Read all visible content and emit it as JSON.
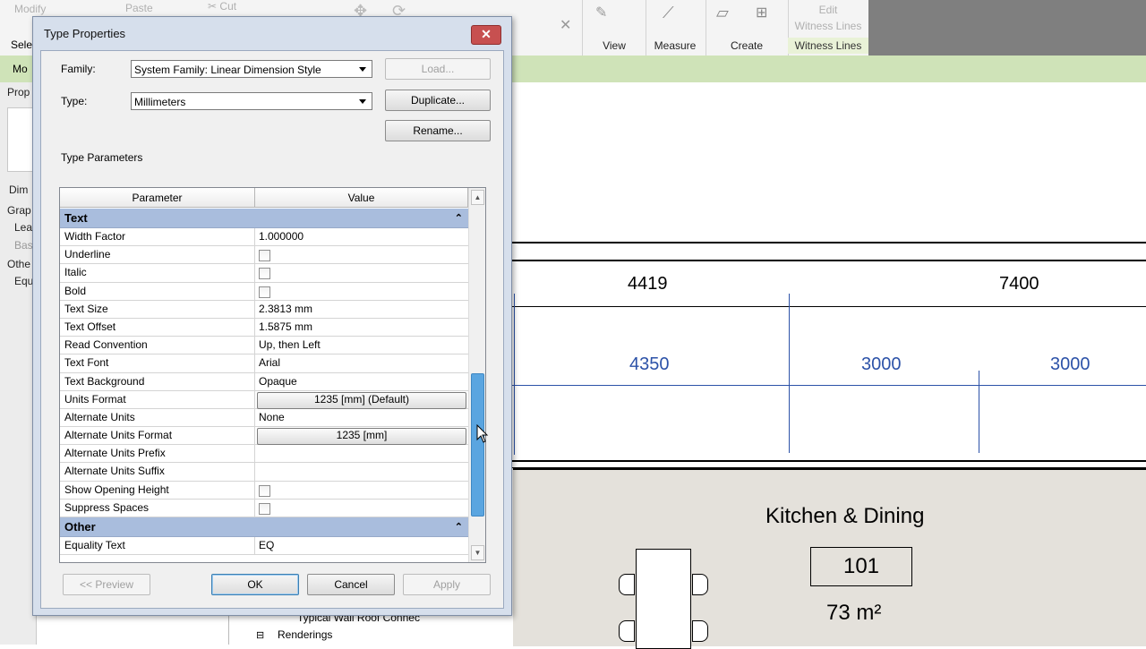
{
  "ribbon": {
    "modify_label": "Modify",
    "paste_label": "Paste",
    "cut_label": "Cut",
    "select_label": "Sele",
    "panels": [
      {
        "label": "View"
      },
      {
        "label": "Measure"
      },
      {
        "label": "Create"
      }
    ],
    "edit_witness": "Edit\nWitness Lines",
    "witness_lines_label": "Witness Lines",
    "context_tab": "Mo"
  },
  "left_panel": {
    "items": [
      "Prop",
      "Dim",
      "Grap",
      "Lea",
      "Bas",
      "Othe",
      "Equ"
    ]
  },
  "drawing": {
    "dims_top": [
      "4419",
      "7400"
    ],
    "dims_blue": [
      "4350",
      "3000",
      "3000"
    ],
    "room_name": "Kitchen & Dining",
    "room_number": "101",
    "room_area": "73 m²",
    "browser_items": [
      "Typical Wall Roof Connec",
      "Renderings"
    ]
  },
  "dialog": {
    "title": "Type Properties",
    "family_label": "Family:",
    "family_value": "System Family: Linear Dimension Style",
    "type_label": "Type:",
    "type_value": "Millimeters",
    "load_label": "Load...",
    "duplicate_label": "Duplicate...",
    "rename_label": "Rename...",
    "type_parameters_label": "Type Parameters",
    "columns": {
      "parameter": "Parameter",
      "value": "Value"
    },
    "groups": [
      {
        "name": "Text",
        "rows": [
          {
            "name": "Width Factor",
            "value": "1.000000",
            "kind": "text"
          },
          {
            "name": "Underline",
            "value": "",
            "kind": "check"
          },
          {
            "name": "Italic",
            "value": "",
            "kind": "check"
          },
          {
            "name": "Bold",
            "value": "",
            "kind": "check"
          },
          {
            "name": "Text Size",
            "value": "2.3813 mm",
            "kind": "text"
          },
          {
            "name": "Text Offset",
            "value": "1.5875 mm",
            "kind": "text"
          },
          {
            "name": "Read Convention",
            "value": "Up, then Left",
            "kind": "text"
          },
          {
            "name": "Text Font",
            "value": "Arial",
            "kind": "text"
          },
          {
            "name": "Text Background",
            "value": "Opaque",
            "kind": "text"
          },
          {
            "name": "Units Format",
            "value": "1235 [mm] (Default)",
            "kind": "button"
          },
          {
            "name": "Alternate Units",
            "value": "None",
            "kind": "text"
          },
          {
            "name": "Alternate Units Format",
            "value": "1235 [mm]",
            "kind": "button"
          },
          {
            "name": "Alternate Units Prefix",
            "value": "",
            "kind": "text"
          },
          {
            "name": "Alternate Units Suffix",
            "value": "",
            "kind": "text"
          },
          {
            "name": "Show Opening Height",
            "value": "",
            "kind": "check"
          },
          {
            "name": "Suppress Spaces",
            "value": "",
            "kind": "check"
          }
        ]
      },
      {
        "name": "Other",
        "rows": [
          {
            "name": "Equality Text",
            "value": "EQ",
            "kind": "text"
          }
        ]
      }
    ],
    "preview_label": "<< Preview",
    "ok_label": "OK",
    "cancel_label": "Cancel",
    "apply_label": "Apply",
    "close_glyph": "✕",
    "chevron_glyph": "⌃"
  },
  "colors": {
    "group_header": "#a9bddd",
    "scroll_thumb": "#5aa5e0",
    "close_button": "#c75050",
    "dimension_blue": "#2c52a8",
    "context_tab": "#cfe3b8"
  }
}
